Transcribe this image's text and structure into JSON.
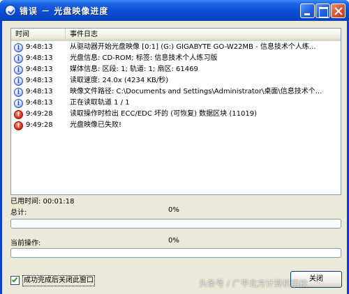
{
  "window": {
    "title": "错误 － 光盘映像进度",
    "title_icon": "check-circle-icon"
  },
  "titlebar_buttons": {
    "minimize_icon": "minimize-icon",
    "maximize_icon": "maximize-icon",
    "close_icon": "close-icon"
  },
  "log": {
    "columns": [
      "时间",
      "事件日志"
    ],
    "rows": [
      {
        "icon": "info",
        "glyph": "i",
        "time": "9:48:13",
        "message": "从驱动器开始光盘映像 [0:1] (G:) GIGABYTE GO-W22MB - 信息技术个人练..."
      },
      {
        "icon": "info",
        "glyph": "i",
        "time": "9:48:13",
        "message": "光盘信息: CD-ROM; 标签: 信息技术个人练习版"
      },
      {
        "icon": "info",
        "glyph": "i",
        "time": "9:48:13",
        "message": "媒体信息: 区段: 1; 轨道: 1; 扇区: 61469"
      },
      {
        "icon": "info",
        "glyph": "i",
        "time": "9:48:13",
        "message": "读取速度: 24.0x (4234 KB/秒)"
      },
      {
        "icon": "info",
        "glyph": "i",
        "time": "9:48:13",
        "message": "映像文件路径: C:\\Documents and Settings\\Administrator\\桌面\\信息技术个..."
      },
      {
        "icon": "info",
        "glyph": "i",
        "time": "9:48:13",
        "message": "正在读取轨道 1 / 1"
      },
      {
        "icon": "error",
        "glyph": "!",
        "time": "9:49:28",
        "message": "读取操作时检出 ECC/EDC 坏的 (可恢复) 数据区块 (11019)"
      },
      {
        "icon": "error",
        "glyph": "!",
        "time": "9:49:28",
        "message": "光盘映像已失败!"
      }
    ]
  },
  "status": {
    "elapsed": "已用时间: 00:01:18",
    "total_label": "总计:",
    "total_percent": "0%",
    "total_progress": 0,
    "current_label": "当前操作:",
    "current_percent": "0%",
    "current_progress": 0
  },
  "footer": {
    "checkbox_label": "成功完成后关闭此窗口",
    "checkbox_checked": true,
    "close_button": "关闭"
  },
  "watermark": "头条号 / 广平北方计算机学校"
}
